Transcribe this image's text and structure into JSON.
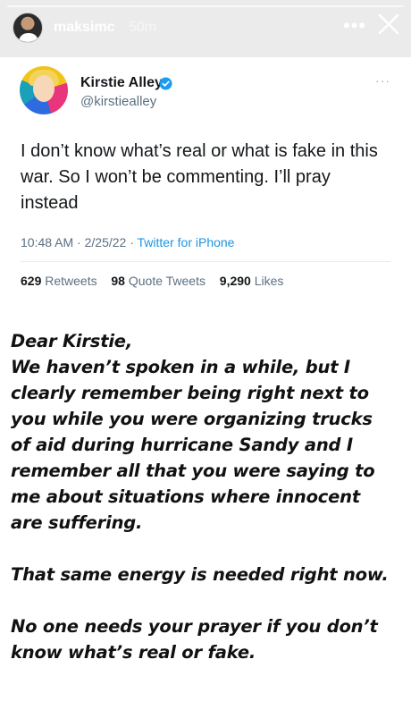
{
  "story": {
    "username": "maksimc",
    "time_ago": "50m",
    "more_icon": "more-horizontal-icon",
    "close_icon": "close-icon"
  },
  "tweet": {
    "display_name": "Kirstie Alley",
    "handle": "@kirstiealley",
    "verified_color": "#1d9bf0",
    "text": "I don’t know what’s real or what is fake in this war. So I won’t be commenting. I’ll pray instead",
    "time": "10:48 AM",
    "date": "2/25/22",
    "source": "Twitter for iPhone",
    "retweets_count": "629",
    "retweets_label": "Retweets",
    "quote_count": "98",
    "quote_label": "Quote Tweets",
    "likes_count": "9,290",
    "likes_label": "Likes",
    "more_dots": "···"
  },
  "caption": {
    "line1": "Dear Kirstie,",
    "line2": "We haven’t spoken in a while, but I",
    "line3": "clearly remember being right next to",
    "line4": "you while you were organizing trucks",
    "line5": "of aid during hurricane Sandy and I",
    "line6": "remember all that you were saying to",
    "line7": "me about situations where innocent",
    "line8": "are suffering.",
    "line9": "That same energy is needed right now.",
    "line10": "No one needs your prayer if you don’t",
    "line11": "know what’s real or fake."
  }
}
